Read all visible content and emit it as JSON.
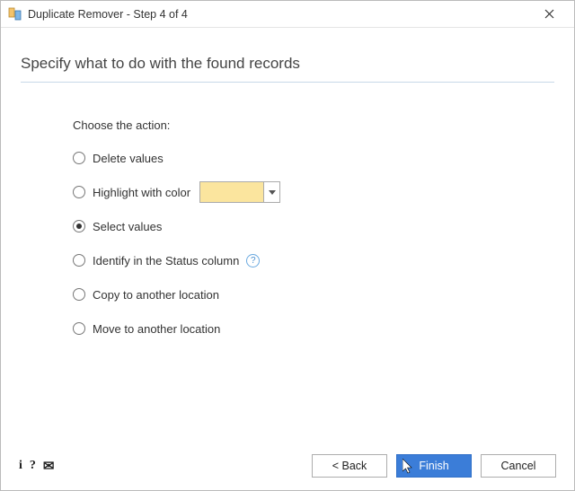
{
  "window": {
    "title": "Duplicate Remover - Step 4 of 4"
  },
  "heading": "Specify what to do with the found records",
  "section": {
    "prompt": "Choose the action:",
    "options": {
      "delete": "Delete values",
      "highlight": "Highlight with color",
      "select": "Select values",
      "identify": "Identify in the Status column",
      "copy": "Copy to another location",
      "move": "Move to another location"
    },
    "selected": "select",
    "highlight_color": "#fbe59e"
  },
  "footer": {
    "back": "< Back",
    "finish": "Finish",
    "cancel": "Cancel"
  }
}
